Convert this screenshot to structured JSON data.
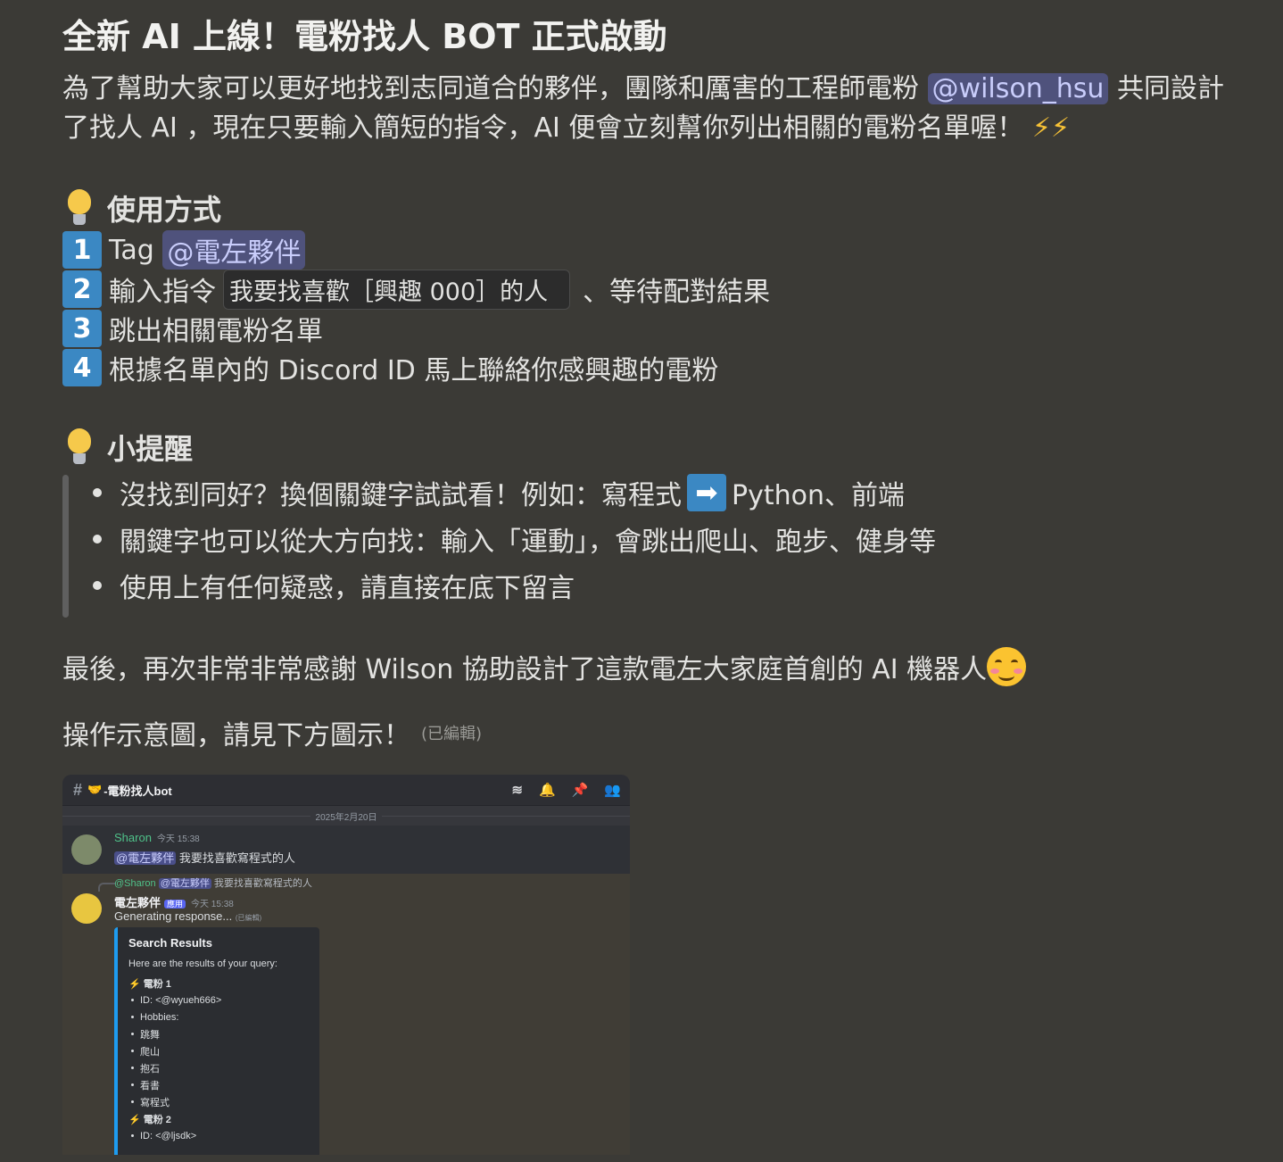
{
  "post": {
    "title": "全新 AI 上線！電粉找人 BOT 正式啟動",
    "intro_part1": "為了幫助大家可以更好地找到志同道合的夥伴，團隊和厲害的工程師電粉 ",
    "intro_mention": "@wilson_hsu",
    "intro_part2": " 共同設計了找人 AI ，現在只要輸入簡短的指令，AI 便會立刻幫你列出相關的電粉名單喔！",
    "intro_emoji": "⚡⚡",
    "usage_heading": "使用方式",
    "steps": [
      {
        "num": "1",
        "text": "Tag ",
        "mention": "@電左夥伴"
      },
      {
        "num": "2",
        "text": "輸入指令",
        "code": "我要找喜歡［興趣 000］的人",
        "after": "、等待配對結果"
      },
      {
        "num": "3",
        "text": "跳出相關電粉名單"
      },
      {
        "num": "4",
        "text": "根據名單內的 Discord ID 馬上聯絡你感興趣的電粉"
      }
    ],
    "tips_heading": "小提醒",
    "tips": [
      {
        "before": "沒找到同好？換個關鍵字試試看！例如：寫程式",
        "arrow": "➡",
        "after": "Python、前端"
      },
      {
        "before": "關鍵字也可以從大方向找：輸入「運動」，會跳出爬山、跑步、健身等"
      },
      {
        "before": "使用上有任何疑惑，請直接在底下留言"
      }
    ],
    "thanks": "最後，再次非常非常感謝 Wilson 協助設計了這款電左大家庭首創的 AI 機器人",
    "see_below": "操作示意圖，請見下方圖示！",
    "edited": "(已編輯)"
  },
  "screenshot": {
    "channel": "-電粉找人bot",
    "date": "2025年2月20日",
    "msg1": {
      "name": "Sharon",
      "time": "今天 15:38",
      "mention": "@電左夥伴",
      "text": " 我要找喜歡寫程式的人"
    },
    "msg2": {
      "reply_user": "@Sharon",
      "reply_mention": "@電左夥伴",
      "reply_text": " 我要找喜歡寫程式的人",
      "name": "電左夥伴",
      "badge": "應用",
      "time": "今天 15:38",
      "body": "Generating response...",
      "edited": "(已編輯)"
    },
    "embed": {
      "title": "Search Results",
      "desc": "Here are the results of your query:",
      "lines": [
        {
          "text": "⚡ 電粉 1",
          "bold": true
        },
        {
          "text": "ID: <@wyueh666>"
        },
        {
          "text": "Hobbies:"
        },
        {
          "text": "跳舞"
        },
        {
          "text": "爬山"
        },
        {
          "text": "抱石"
        },
        {
          "text": "看書"
        },
        {
          "text": "寫程式"
        },
        {
          "text": "⚡ 電粉 2",
          "bold": true
        },
        {
          "text": "ID: <@ljsdk>"
        }
      ]
    }
  },
  "colors": {
    "background": "#3b3a36",
    "mention_bg": "#4f527c",
    "keycap": "#3b88c3",
    "embed_bar": "#1e9cf0"
  }
}
